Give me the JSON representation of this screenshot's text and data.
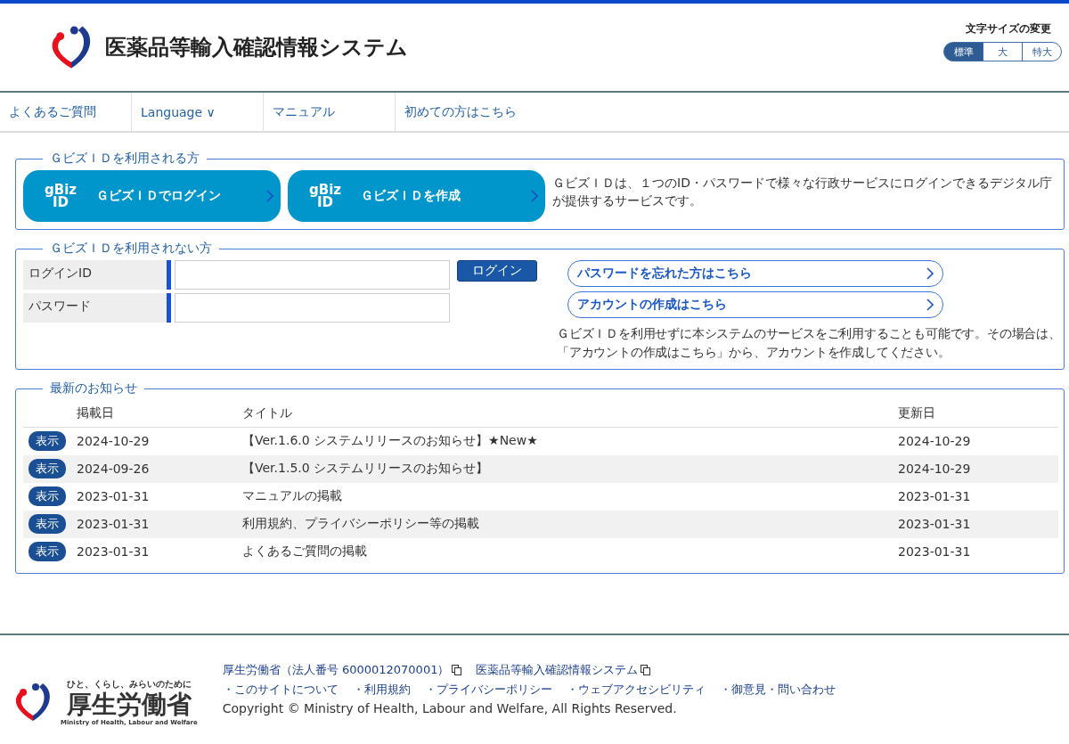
{
  "header": {
    "title": "医薬品等輸入確認情報システム",
    "font_size": {
      "label": "文字サイズの変更",
      "options": [
        {
          "label": "標準",
          "selected": true
        },
        {
          "label": "大",
          "selected": false
        },
        {
          "label": "特大",
          "selected": false
        }
      ]
    }
  },
  "nav": [
    {
      "label": "よくあるご質問"
    },
    {
      "label": "Language ∨"
    },
    {
      "label": "マニュアル"
    },
    {
      "label": "初めての方はこちら"
    }
  ],
  "gbiz_section": {
    "legend": "ＧビズＩＤを利用される方",
    "buttons": [
      {
        "logo_top": "gBiz",
        "logo_bottom": "ID",
        "label": "ＧビズＩＤでログイン"
      },
      {
        "logo_top": "gBiz",
        "logo_bottom": "ID",
        "label": "ＧビズＩＤを作成"
      }
    ],
    "description": "ＧビズＩＤは、１つのID・パスワードで様々な行政サービスにログインできるデジタル庁が提供するサービスです。"
  },
  "login_section": {
    "legend": "ＧビズＩＤを利用されない方",
    "fields": [
      {
        "label": "ログインID"
      },
      {
        "label": "パスワード"
      }
    ],
    "login_button": "ログイン",
    "links": [
      "パスワードを忘れた方はこちら",
      "アカウントの作成はこちら"
    ],
    "note": "ＧビズＩＤを利用せずに本システムのサービスをご利用することも可能です。その場合は、「アカウントの作成はこちら」から、アカウントを作成してください。"
  },
  "news": {
    "legend": "最新のお知らせ",
    "columns": [
      "掲載日",
      "タイトル",
      "更新日"
    ],
    "rows": [
      {
        "button": "表示",
        "date": "2024-10-29",
        "title": "【Ver.1.6.0 システムリリースのお知らせ】★New★",
        "updated": "2024-10-29"
      },
      {
        "button": "表示",
        "date": "2024-09-26",
        "title": "【Ver.1.5.0 システムリリースのお知らせ】",
        "updated": "2024-10-29"
      },
      {
        "button": "表示",
        "date": "2023-01-31",
        "title": "マニュアルの掲載",
        "updated": "2023-01-31"
      },
      {
        "button": "表示",
        "date": "2023-01-31",
        "title": "利用規約、プライバシーポリシー等の掲載",
        "updated": "2023-01-31"
      },
      {
        "button": "表示",
        "date": "2023-01-31",
        "title": "よくあるご質問の掲載",
        "updated": "2023-01-31"
      }
    ]
  },
  "footer": {
    "logo": {
      "tagline": "ひと、くらし、みらいのために",
      "name": "厚生労働省",
      "english": "Ministry of Health, Labour and Welfare"
    },
    "top_links": [
      "厚生労働省（法人番号 6000012070001）",
      "医薬品等輸入確認情報システム"
    ],
    "links": [
      "・このサイトについて",
      "・利用規約",
      "・プライバシーポリシー",
      "・ウェブアクセシビリティ",
      "・御意見・問い合わせ"
    ],
    "copyright": "Copyright © Ministry of Health, Labour and Welfare, All Rights Reserved."
  }
}
